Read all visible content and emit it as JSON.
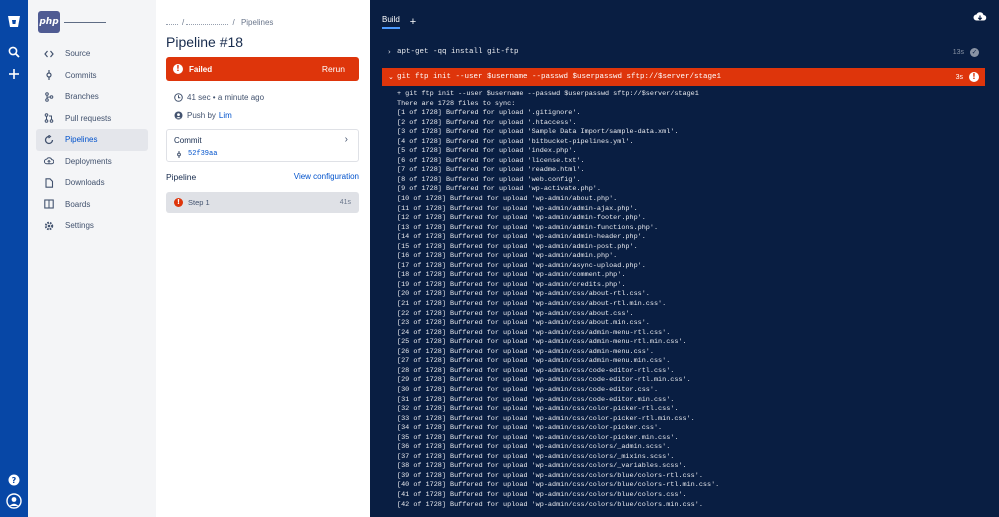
{
  "nav": {
    "items": [
      {
        "label": "Source",
        "icon": "source-icon"
      },
      {
        "label": "Commits",
        "icon": "commits-icon"
      },
      {
        "label": "Branches",
        "icon": "branches-icon"
      },
      {
        "label": "Pull requests",
        "icon": "pull-requests-icon"
      },
      {
        "label": "Pipelines",
        "icon": "pipelines-icon",
        "active": true
      },
      {
        "label": "Deployments",
        "icon": "deployments-icon"
      },
      {
        "label": "Downloads",
        "icon": "downloads-icon"
      },
      {
        "label": "Boards",
        "icon": "boards-icon"
      },
      {
        "label": "Settings",
        "icon": "settings-icon"
      }
    ]
  },
  "project": {
    "logo_text": "php"
  },
  "breadcrumb": {
    "current": "Pipelines",
    "separator": "/"
  },
  "pipeline": {
    "title": "Pipeline #18",
    "status": "Failed",
    "rerun_label": "Rerun",
    "duration": "41 sec • a minute ago",
    "push_prefix": "Push by",
    "push_user": "Lim",
    "commit_label": "Commit",
    "commit_hash": "52f39aa",
    "pipeline_label": "Pipeline",
    "view_config_label": "View configuration",
    "step_name": "Step 1",
    "step_duration": "41s"
  },
  "colors": {
    "failed": "#de350b",
    "accent": "#0052cc",
    "log_bg": "#091e42",
    "global_bar": "#0747a6"
  },
  "log": {
    "tab_label": "Build",
    "tab_add": "+",
    "commands": [
      {
        "text": "apt-get -qq install git-ftp",
        "time": "13s",
        "status": "success"
      },
      {
        "text": "git ftp init --user $username --passwd $userpasswd sftp://$server/stage1",
        "time": "3s",
        "status": "failed"
      }
    ],
    "lines": [
      "+ git ftp init --user $username --passwd $userpasswd sftp://$server/stage1",
      "There are 1728 files to sync:",
      "[1 of 1728] Buffered for upload '.gitignore'.",
      "[2 of 1728] Buffered for upload '.htaccess'.",
      "[3 of 1728] Buffered for upload 'Sample Data Import/sample-data.xml'.",
      "[4 of 1728] Buffered for upload 'bitbucket-pipelines.yml'.",
      "[5 of 1728] Buffered for upload 'index.php'.",
      "[6 of 1728] Buffered for upload 'license.txt'.",
      "[7 of 1728] Buffered for upload 'readme.html'.",
      "[8 of 1728] Buffered for upload 'web.config'.",
      "[9 of 1728] Buffered for upload 'wp-activate.php'.",
      "[10 of 1728] Buffered for upload 'wp-admin/about.php'.",
      "[11 of 1728] Buffered for upload 'wp-admin/admin-ajax.php'.",
      "[12 of 1728] Buffered for upload 'wp-admin/admin-footer.php'.",
      "[13 of 1728] Buffered for upload 'wp-admin/admin-functions.php'.",
      "[14 of 1728] Buffered for upload 'wp-admin/admin-header.php'.",
      "[15 of 1728] Buffered for upload 'wp-admin/admin-post.php'.",
      "[16 of 1728] Buffered for upload 'wp-admin/admin.php'.",
      "[17 of 1728] Buffered for upload 'wp-admin/async-upload.php'.",
      "[18 of 1728] Buffered for upload 'wp-admin/comment.php'.",
      "[19 of 1728] Buffered for upload 'wp-admin/credits.php'.",
      "[20 of 1728] Buffered for upload 'wp-admin/css/about-rtl.css'.",
      "[21 of 1728] Buffered for upload 'wp-admin/css/about-rtl.min.css'.",
      "[22 of 1728] Buffered for upload 'wp-admin/css/about.css'.",
      "[23 of 1728] Buffered for upload 'wp-admin/css/about.min.css'.",
      "[24 of 1728] Buffered for upload 'wp-admin/css/admin-menu-rtl.css'.",
      "[25 of 1728] Buffered for upload 'wp-admin/css/admin-menu-rtl.min.css'.",
      "[26 of 1728] Buffered for upload 'wp-admin/css/admin-menu.css'.",
      "[27 of 1728] Buffered for upload 'wp-admin/css/admin-menu.min.css'.",
      "[28 of 1728] Buffered for upload 'wp-admin/css/code-editor-rtl.css'.",
      "[29 of 1728] Buffered for upload 'wp-admin/css/code-editor-rtl.min.css'.",
      "[30 of 1728] Buffered for upload 'wp-admin/css/code-editor.css'.",
      "[31 of 1728] Buffered for upload 'wp-admin/css/code-editor.min.css'.",
      "[32 of 1728] Buffered for upload 'wp-admin/css/color-picker-rtl.css'.",
      "[33 of 1728] Buffered for upload 'wp-admin/css/color-picker-rtl.min.css'.",
      "[34 of 1728] Buffered for upload 'wp-admin/css/color-picker.css'.",
      "[35 of 1728] Buffered for upload 'wp-admin/css/color-picker.min.css'.",
      "[36 of 1728] Buffered for upload 'wp-admin/css/colors/_admin.scss'.",
      "[37 of 1728] Buffered for upload 'wp-admin/css/colors/_mixins.scss'.",
      "[38 of 1728] Buffered for upload 'wp-admin/css/colors/_variables.scss'.",
      "[39 of 1728] Buffered for upload 'wp-admin/css/colors/blue/colors-rtl.css'.",
      "[40 of 1728] Buffered for upload 'wp-admin/css/colors/blue/colors-rtl.min.css'.",
      "[41 of 1728] Buffered for upload 'wp-admin/css/colors/blue/colors.css'.",
      "[42 of 1728] Buffered for upload 'wp-admin/css/colors/blue/colors.min.css'."
    ]
  }
}
